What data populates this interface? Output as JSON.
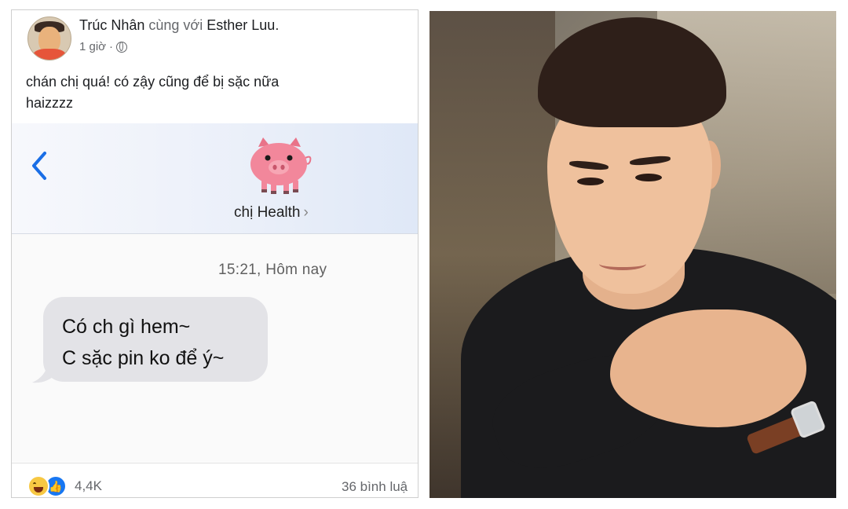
{
  "post": {
    "author": "Trúc Nhân",
    "with_text": "cùng với",
    "tagged": "Esther Luu",
    "tagged_suffix": ".",
    "time": "1 giờ",
    "time_sep": "·",
    "privacy_icon": "globe-icon",
    "text": "chán chị quá! có zậy cũng để bị sặc nữa\nhaizzzz"
  },
  "screenshot": {
    "back_icon": "chevron-left-icon",
    "contact_avatar": "pig-emoji-icon",
    "contact_name": "chị Health",
    "contact_chevron": "›",
    "timestamp": "15:21, Hôm nay",
    "message_lines": [
      "Có ch gì hem~",
      "C sặc pin ko để ý~"
    ]
  },
  "footer": {
    "reaction_icons": [
      "haha-reaction-icon",
      "like-reaction-icon"
    ],
    "reaction_count": "4,4K",
    "comments": "36 bình luậ"
  },
  "colors": {
    "like_blue": "#1877f2",
    "ios_blue": "#1a6ee6",
    "bubble_gray": "#e3e3e7",
    "pig_pink": "#f2879b"
  }
}
